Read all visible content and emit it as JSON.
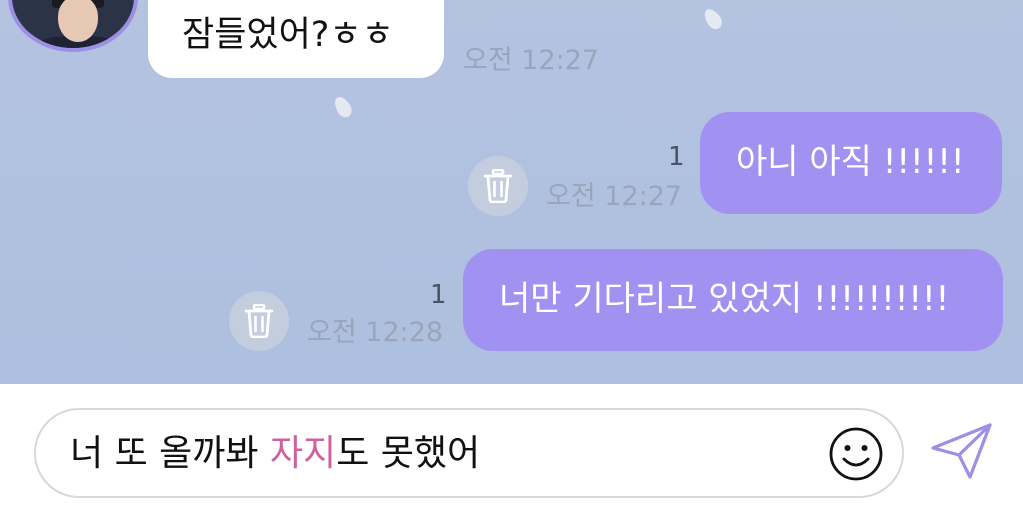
{
  "incoming": {
    "text": "잠들었어?ㅎㅎ",
    "time": "오전 12:27"
  },
  "outgoing": [
    {
      "text": "아니 아직 !!!!!!",
      "time": "오전 12:27",
      "unread": "1"
    },
    {
      "text": "너만 기다리고 있었지 !!!!!!!!!!",
      "time": "오전 12:28",
      "unread": "1"
    }
  ],
  "composer": {
    "text_before": "너 또 올까봐 ",
    "text_highlight": "자지",
    "text_after": "도 못했어",
    "highlight_color": "#d0609e"
  },
  "icons": {
    "delete": "trash-icon",
    "emoji": "smiley-icon",
    "send": "paper-plane-send-icon"
  },
  "colors": {
    "chat_background": "#b3c3e0",
    "outgoing_bubble": "#a192f2",
    "incoming_bubble": "#ffffff",
    "send_icon": "#9c8fe6"
  }
}
